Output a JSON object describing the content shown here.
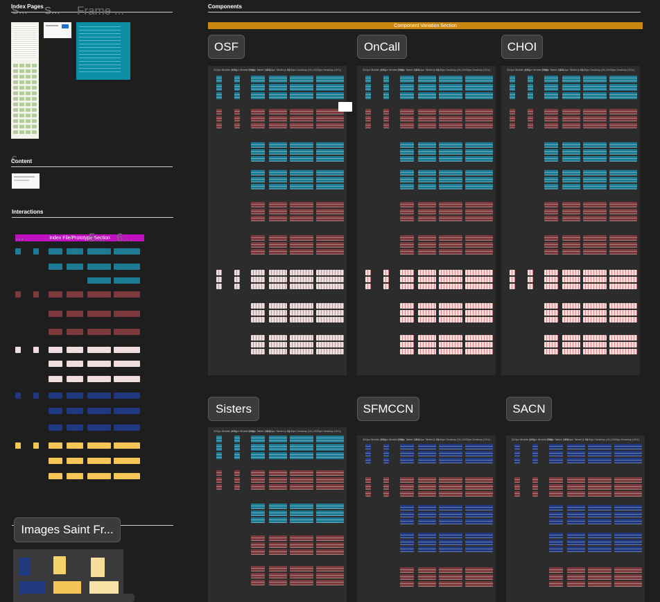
{
  "sections": {
    "index_pages": "Index Pages",
    "content": "Content",
    "interactions": "Interactions",
    "components": "Components"
  },
  "index_ghost_labels": [
    "S...",
    "S...",
    "Frame ..."
  ],
  "content_ghost_label": "C...",
  "interactions_banner": "Index File/Prototype Section",
  "component_banner": "Component Variation Section",
  "component_groups": [
    "OSF",
    "OnCall",
    "CHOI",
    "Sisters",
    "SFMCCN",
    "SACN"
  ],
  "images_label": "Images Saint Fr...",
  "breakpoint_labels": [
    "320px Mobile (XS)",
    "414px Mobile (SM)",
    "768px Tablet (MD)",
    "1024px Tablet (LG)",
    "1440px Desktop (XL)",
    "1920px Desktop (XXL)"
  ],
  "interaction_ghosts": [
    "...",
    "5...",
    "6..."
  ],
  "colors": {
    "canvas": "#1e1e1e",
    "component_banner": "#c9870f",
    "interactions_banner": "#c011c0",
    "teal": "#1d7b93",
    "red": "#7c3a3c",
    "blush": "#f0dede",
    "navy": "#1f3880",
    "yellow": "#f3c655"
  }
}
